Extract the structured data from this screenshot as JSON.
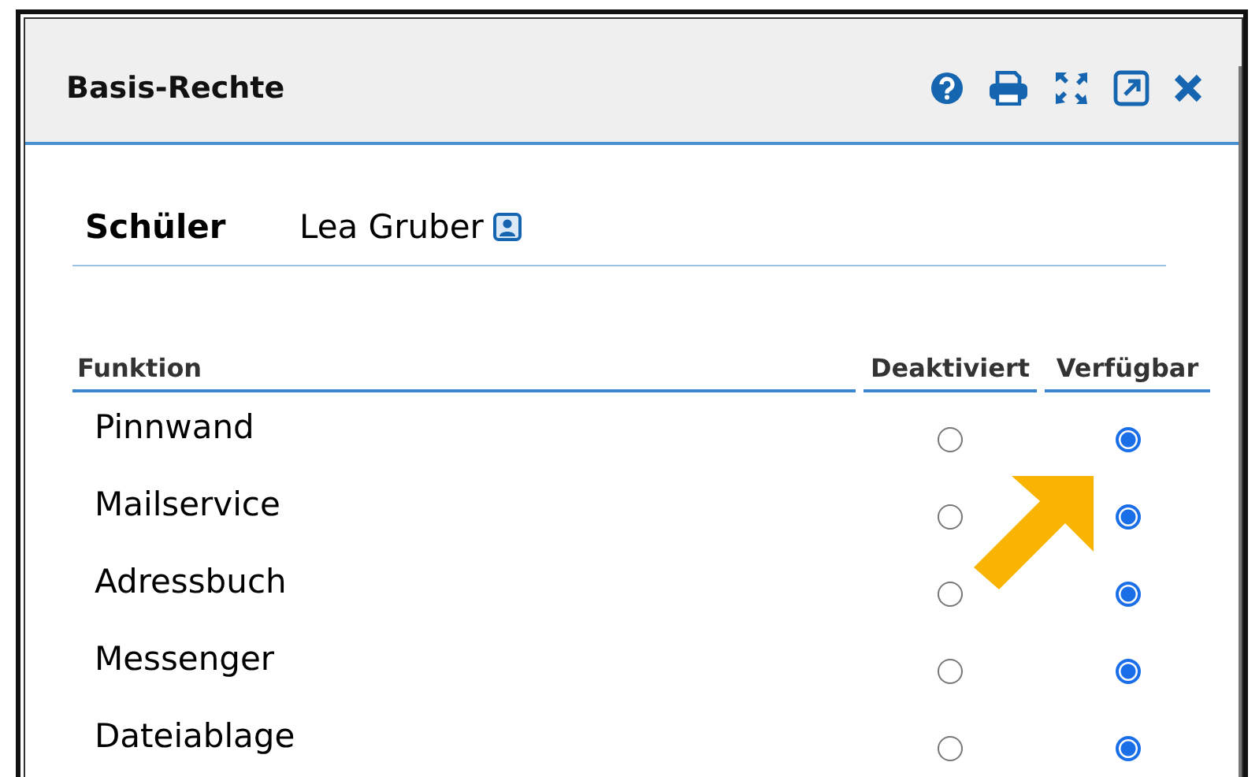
{
  "window": {
    "title": "Basis-Rechte"
  },
  "person": {
    "label": "Schüler",
    "name": "Lea Gruber"
  },
  "table": {
    "columns": [
      "Funktion",
      "Deaktiviert",
      "Verfügbar"
    ],
    "rows": [
      {
        "label": "Pinnwand",
        "options": [
          {
            "selected": false
          },
          {
            "selected": true
          }
        ]
      },
      {
        "label": "Mailservice",
        "options": [
          {
            "selected": false
          },
          {
            "selected": true
          }
        ]
      },
      {
        "label": "Adressbuch",
        "options": [
          {
            "selected": false
          },
          {
            "selected": true
          }
        ]
      },
      {
        "label": "Messenger",
        "options": [
          {
            "selected": false
          },
          {
            "selected": true
          }
        ]
      },
      {
        "label": "Dateiablage",
        "options": [
          {
            "selected": false
          },
          {
            "selected": true
          }
        ]
      }
    ]
  }
}
